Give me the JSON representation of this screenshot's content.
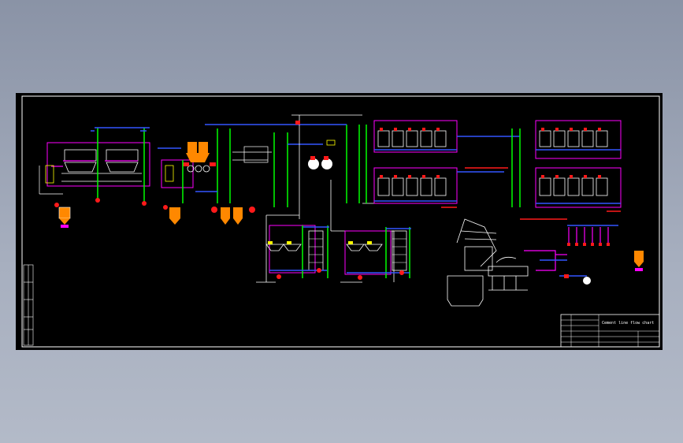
{
  "drawing": {
    "title_block": {
      "title": "Cement line flow chart",
      "rows": [
        "",
        "",
        "",
        "",
        "",
        ""
      ]
    }
  },
  "colors": {
    "background": "#000000",
    "frame": "#ffffff",
    "magenta": "#ff00ff",
    "green": "#00ff00",
    "blue": "#3355ff",
    "red": "#ff1a1a",
    "orange": "#ff8800",
    "white": "#ffffff",
    "cyan": "#00ffff"
  }
}
